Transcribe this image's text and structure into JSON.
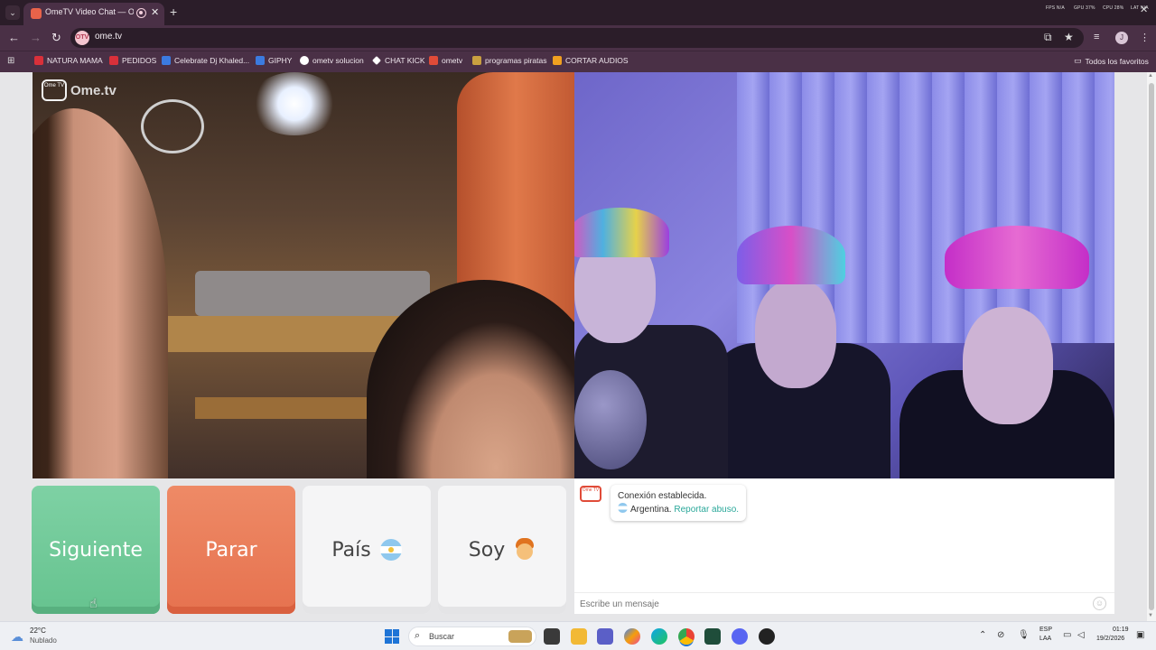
{
  "browser": {
    "tab_title": "OmeTV Video Chat — Ome",
    "url": "ome.tv",
    "site_chip": "OTV",
    "profile_initial": "J",
    "stats": [
      "FPS N/A",
      "GPU 37%",
      "CPU 28%",
      "LAT N/A"
    ],
    "bookmarks": [
      {
        "label": "NATURA MAMA",
        "color": "#d9303a"
      },
      {
        "label": "PEDIDOS",
        "color": "#d9303a"
      },
      {
        "label": "Celebrate Dj Khaled...",
        "color": "#3b7be0"
      },
      {
        "label": "GIPHY",
        "color": "#3b7be0"
      },
      {
        "label": "ometv solucion",
        "color": "#ffffff"
      },
      {
        "label": "CHAT KICK",
        "color": "#ffffff"
      },
      {
        "label": "ometv",
        "color": "#e04b38"
      },
      {
        "label": "programas piratas",
        "color": "#c9a040"
      },
      {
        "label": "CORTAR AUDIOS",
        "color": "#f0a020"
      }
    ],
    "bookmarks_all": "Todos los favoritos"
  },
  "app": {
    "logo_text": "Ome.tv",
    "logo_box": "Ome TV",
    "buttons": {
      "next": "Siguiente",
      "stop": "Parar",
      "country": "País",
      "me": "Soy"
    },
    "chat": {
      "logo_box": "Ome TV",
      "status": "Conexión establecida.",
      "country": "Argentina.",
      "report": "Reportar abuso.",
      "input_placeholder": "Escribe un mensaje"
    }
  },
  "taskbar": {
    "weather_temp": "22°C",
    "weather_cond": "Nublado",
    "search_label": "Buscar",
    "lang_top": "ESP",
    "lang_bottom": "LAA",
    "time": "01:19",
    "date": "19/2/2026"
  },
  "colors": {
    "next": "#6fca98",
    "stop": "#eb7a56",
    "accent_link": "#2aa89a"
  }
}
